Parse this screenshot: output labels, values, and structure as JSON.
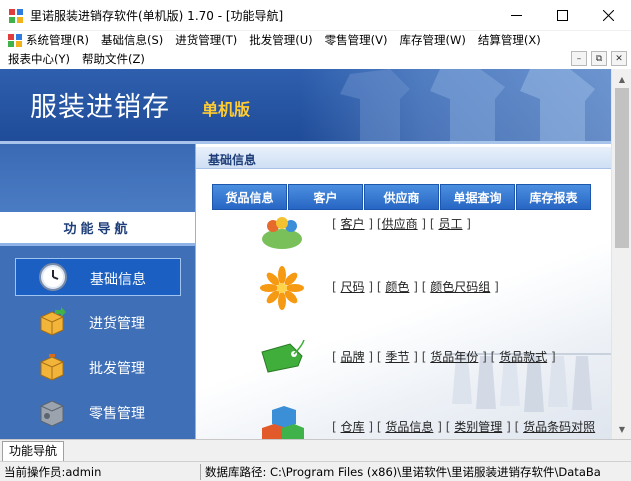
{
  "window": {
    "title": "里诺服装进销存软件(单机版) 1.70 - [功能导航]",
    "min_glyph": "—",
    "max_glyph": "☐",
    "close_glyph": "✕"
  },
  "menu": {
    "row1": [
      "系统管理(R)",
      "基础信息(S)",
      "进货管理(T)",
      "批发管理(U)",
      "零售管理(V)",
      "库存管理(W)",
      "结算管理(X)"
    ],
    "row2": [
      "报表中心(Y)",
      "帮助文件(Z)"
    ],
    "mdi_controls": [
      "–",
      "⧉",
      "✕"
    ]
  },
  "banner": {
    "title": "服装进销存",
    "subtitle": "单机版"
  },
  "nav": {
    "header": "功能导航",
    "items": [
      {
        "label": "基础信息",
        "icon": "clock-icon",
        "active": true
      },
      {
        "label": "进货管理",
        "icon": "box-in-icon",
        "active": false
      },
      {
        "label": "批发管理",
        "icon": "box-out-icon",
        "active": false
      },
      {
        "label": "零售管理",
        "icon": "safe-icon",
        "active": false
      }
    ]
  },
  "content": {
    "title": "基础信息",
    "tabs": [
      "货品信息",
      "客户",
      "供应商",
      "单据查询",
      "库存报表"
    ],
    "groups": [
      {
        "icon": "people-icon",
        "links": [
          "客户",
          "供应商",
          "员工"
        ]
      },
      {
        "icon": "flower-icon",
        "links": [
          "尺码",
          "颜色",
          "颜色尺码组"
        ]
      },
      {
        "icon": "tag-icon",
        "links": [
          "品牌",
          "季节",
          "货品年份",
          "货品款式"
        ]
      },
      {
        "icon": "cubes-icon",
        "links": [
          "仓库",
          "货品信息",
          "类别管理",
          "货品条码对照"
        ]
      }
    ]
  },
  "mdi_tab": "功能导航",
  "status": {
    "operator": "当前操作员:admin",
    "db_path": "数据库路径: C:\\Program Files (x86)\\里诺软件\\里诺服装进销存软件\\DataBa"
  },
  "colors": {
    "banner_blue": "#2e5fae",
    "nav_blue": "#3f6fb7",
    "tab_blue": "#2766c4",
    "subtitle_gold": "#ffcc33"
  }
}
